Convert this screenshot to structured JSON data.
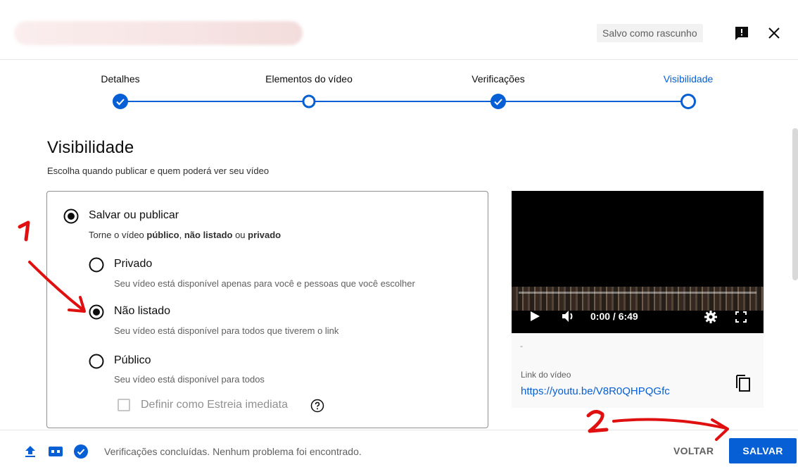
{
  "header": {
    "draft_badge": "Salvo como rascunho",
    "icons": {
      "feedback": "feedback-icon",
      "close": "close-icon"
    }
  },
  "stepper": {
    "steps": [
      {
        "label": "Detalhes",
        "state": "done"
      },
      {
        "label": "Elementos do vídeo",
        "state": "current-incomplete"
      },
      {
        "label": "Verificações",
        "state": "done"
      },
      {
        "label": "Visibilidade",
        "state": "active"
      }
    ]
  },
  "visibility": {
    "title": "Visibilidade",
    "subtitle": "Escolha quando publicar e quem poderá ver seu vídeo",
    "save_or_publish": {
      "label": "Salvar ou publicar",
      "desc_prefix": "Torne o vídeo ",
      "desc_public": "público",
      "desc_sep": ", ",
      "desc_unlisted": "não listado",
      "desc_or": " ou ",
      "desc_private": "privado",
      "selected": true
    },
    "options": [
      {
        "label": "Privado",
        "desc": "Seu vídeo está disponível apenas para você e pessoas que você escolher",
        "selected": false
      },
      {
        "label": "Não listado",
        "desc": "Seu vídeo está disponível para todos que tiverem o link",
        "selected": true
      },
      {
        "label": "Público",
        "desc": "Seu vídeo está disponível para todos",
        "selected": false
      }
    ],
    "premiere_checkbox": {
      "label": "Definir como Estreia imediata",
      "checked": false
    }
  },
  "video": {
    "time": "0:00 / 6:49",
    "title_placeholder": "-",
    "link_label": "Link do vídeo",
    "link_url": "https://youtu.be/V8R0QHPQGfc"
  },
  "footer": {
    "status": "Verificações concluídas. Nenhum problema foi encontrado.",
    "back_label": "VOLTAR",
    "save_label": "SALVAR"
  },
  "annotations": {
    "marker_1": "1",
    "marker_2": "2"
  },
  "colors": {
    "accent": "#065fd4",
    "annotation": "#e01010"
  }
}
